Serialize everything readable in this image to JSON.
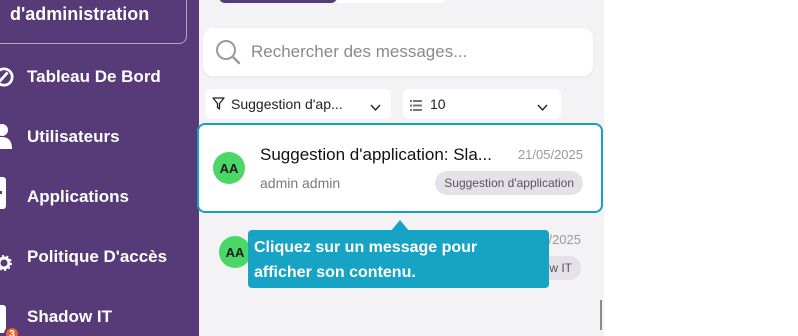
{
  "sidebar": {
    "admin_title": "d'administration",
    "items": [
      {
        "label": "Tableau De Bord",
        "icon": "gauge-icon"
      },
      {
        "label": "Utilisateurs",
        "icon": "user-icon"
      },
      {
        "label": "Applications",
        "icon": "app-icon"
      },
      {
        "label": "Politique D'accès",
        "icon": "gear-icon"
      },
      {
        "label": "Shadow IT",
        "icon": "shadow-icon"
      }
    ],
    "notification_count": "3"
  },
  "search": {
    "placeholder": "Rechercher des messages..."
  },
  "filters": {
    "category_value": "Suggestion d'ap...",
    "per_page_value": "10"
  },
  "messages": [
    {
      "avatar": "AA",
      "subject": "Suggestion d'application: Sla...",
      "date": "21/05/2025",
      "sender": "admin admin",
      "tag": "Suggestion d'application"
    },
    {
      "avatar": "AA",
      "date": "/2025",
      "tag": "w IT"
    }
  ],
  "tooltip": {
    "line1": "Cliquez sur un message pour",
    "line2": "afficher son contenu."
  },
  "colors": {
    "sidebar": "#573b78",
    "accent": "#1a9fbf",
    "avatar": "#4bd668",
    "badge": "#e8632c"
  }
}
